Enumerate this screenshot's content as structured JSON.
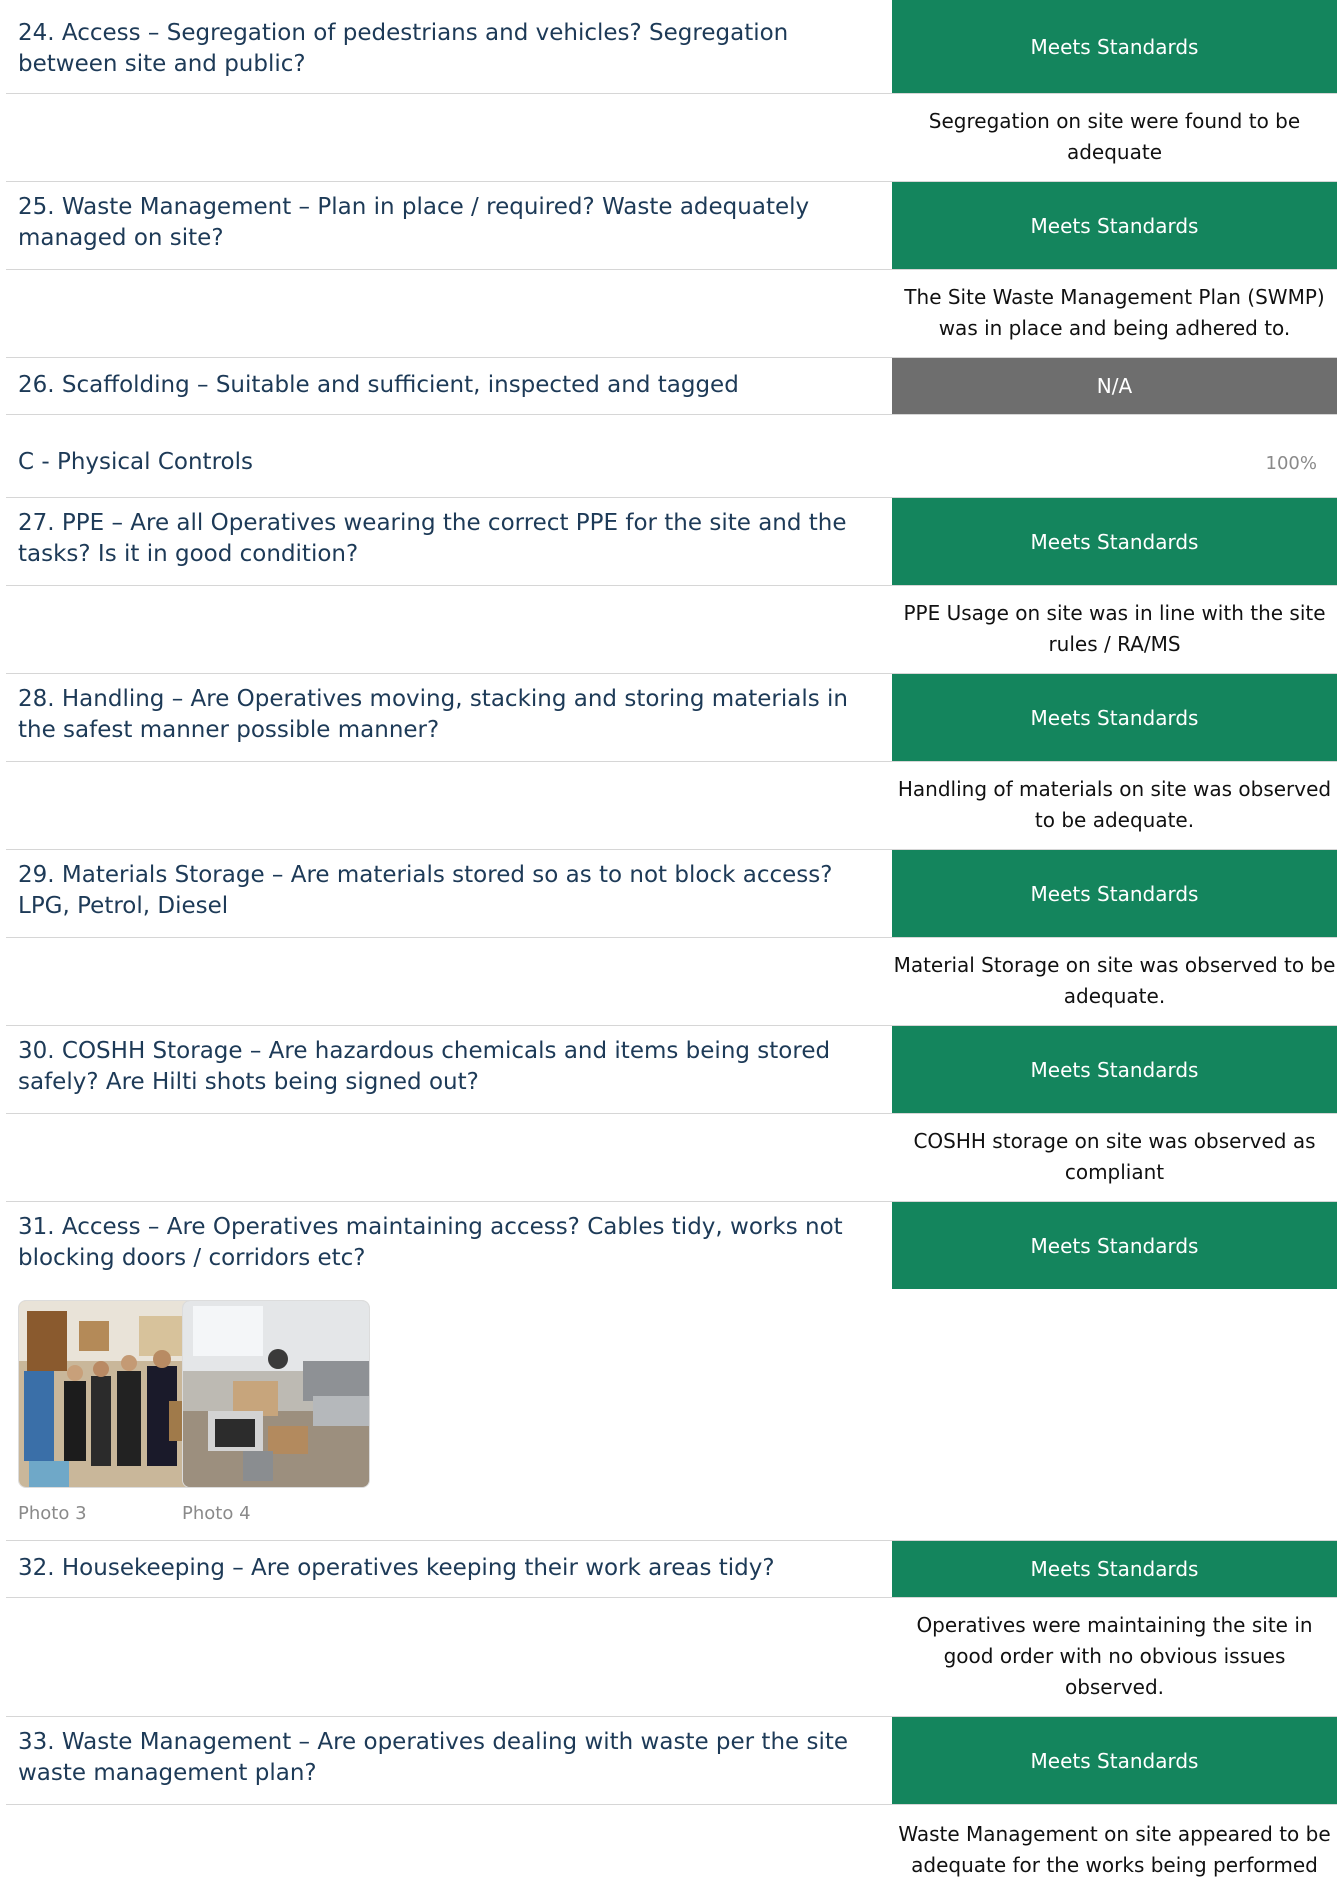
{
  "colors": {
    "meets": "#14855d",
    "na": "#6e6e6e",
    "text": "#1d3a57"
  },
  "questions": [
    {
      "id": "q24",
      "text": "24. Access – Segregation of pedestrians and vehicles? Segregation between site and public?",
      "status": "Meets Standards",
      "comment": "Segregation on site were found to be adequate"
    },
    {
      "id": "q25",
      "text": "25. Waste Management – Plan in place / required? Waste adequately managed on site?",
      "status": "Meets Standards",
      "comment": "The Site Waste Management Plan (SWMP) was in place and being adhered to."
    },
    {
      "id": "q26",
      "text": "26. Scaffolding – Suitable and sufficient, inspected and tagged",
      "status": "N/A"
    },
    {
      "id": "q27",
      "text": "27. PPE – Are all Operatives wearing the correct PPE for the site and the tasks? Is it in good condition?",
      "status": "Meets Standards",
      "comment": "PPE Usage on site was in line with the site rules / RA/MS"
    },
    {
      "id": "q28",
      "text": "28. Handling – Are Operatives moving, stacking and storing materials in the safest manner possible manner?",
      "status": "Meets Standards",
      "comment": "Handling of materials on site was observed to be adequate."
    },
    {
      "id": "q29",
      "text": "29. Materials Storage – Are materials stored so as to not block access? LPG, Petrol, Diesel",
      "status": "Meets Standards",
      "comment": "Material Storage on site was observed to be adequate."
    },
    {
      "id": "q30",
      "text": "30. COSHH Storage – Are hazardous chemicals and items being stored safely? Are Hilti shots being signed out?",
      "status": "Meets Standards",
      "comment": "COSHH storage on site was observed as compliant"
    },
    {
      "id": "q31",
      "text": "31. Access – Are Operatives maintaining access? Cables tidy, works not blocking doors / corridors etc?",
      "status": "Meets Standards",
      "photos": [
        "Photo 3",
        "Photo 4"
      ]
    },
    {
      "id": "q32",
      "text": "32. Housekeeping – Are operatives keeping their work areas tidy?",
      "status": "Meets Standards",
      "comment": "Operatives were maintaining the site in good order with no obvious issues observed."
    },
    {
      "id": "q33",
      "text": "33. Waste Management – Are operatives dealing with waste per the site waste management plan?",
      "status": "Meets Standards",
      "comment": "Waste Management on site appeared to be adequate for the works being performed"
    }
  ],
  "section": {
    "title": "C - Physical Controls",
    "score": "100%"
  }
}
